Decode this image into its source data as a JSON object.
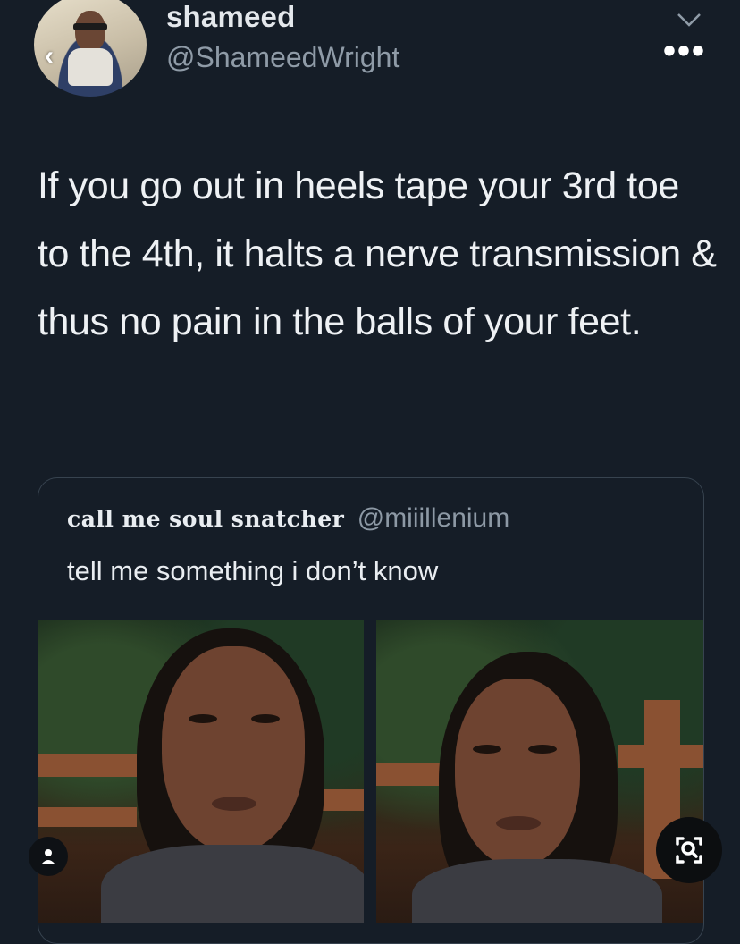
{
  "tweet": {
    "author_name": "shameed",
    "author_handle": "@ShameedWright",
    "text": "If you go out in heels tape your 3rd toe to the 4th, it halts a nerve transmission & thus no pain in the balls of your feet."
  },
  "quoted_tweet": {
    "author_name": "call me soul snatcher",
    "author_handle": "@miiillenium",
    "text": "tell me something i don’t know"
  },
  "controls": {
    "back_glyph": "‹",
    "more_glyph": "•••",
    "icons": [
      "back-icon",
      "chevron-down-icon",
      "more-icon",
      "person-icon",
      "visual-search-icon"
    ]
  },
  "colors": {
    "background": "#151d27",
    "primary_text": "#eef1f4",
    "secondary_text": "#8f9ba7",
    "border": "#37434f"
  }
}
